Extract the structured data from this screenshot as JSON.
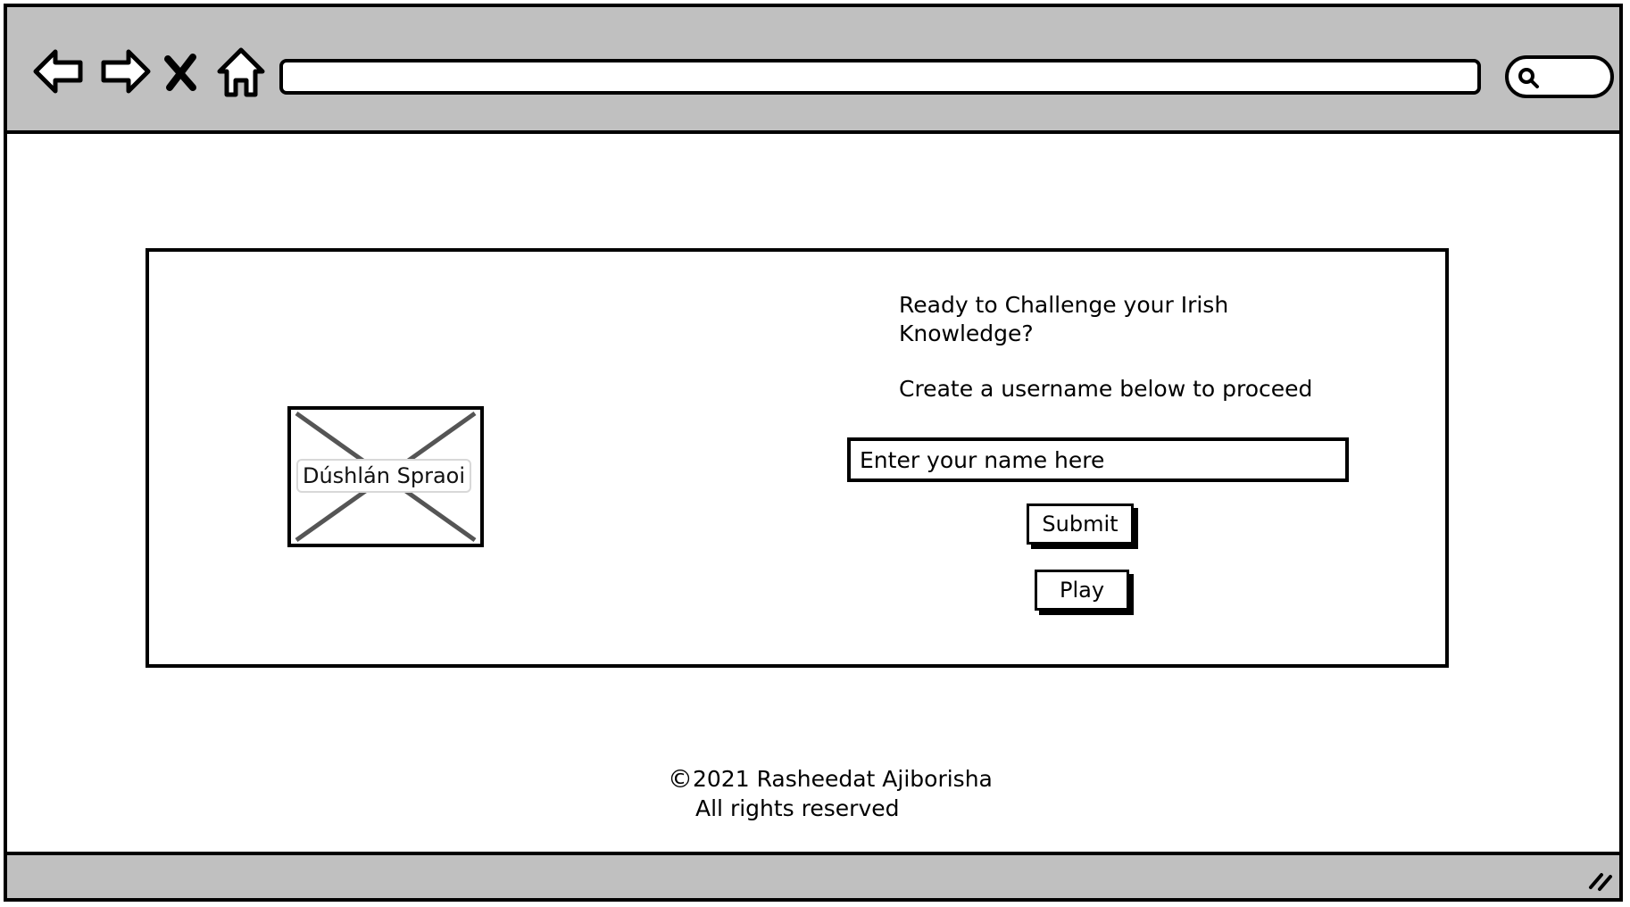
{
  "browser": {
    "icons": {
      "back": "back-arrow-icon",
      "forward": "forward-arrow-icon",
      "stop": "close-icon",
      "home": "home-icon",
      "search": "search-icon"
    },
    "address_value": ""
  },
  "logo": {
    "label": "Dúshlán Spraoi"
  },
  "main": {
    "headline": "Ready to Challenge your Irish Knowledge?",
    "instruction": "Create a username below to proceed",
    "name_placeholder": "Enter your name here",
    "submit_label": "Submit",
    "play_label": "Play"
  },
  "footer": {
    "copyright_symbol": "©",
    "copyright_text": "2021 Rasheedat Ajiborisha",
    "rights_text": "All rights reserved"
  },
  "colors": {
    "chrome": "#c0c0c0",
    "border": "#000000",
    "background": "#ffffff"
  }
}
